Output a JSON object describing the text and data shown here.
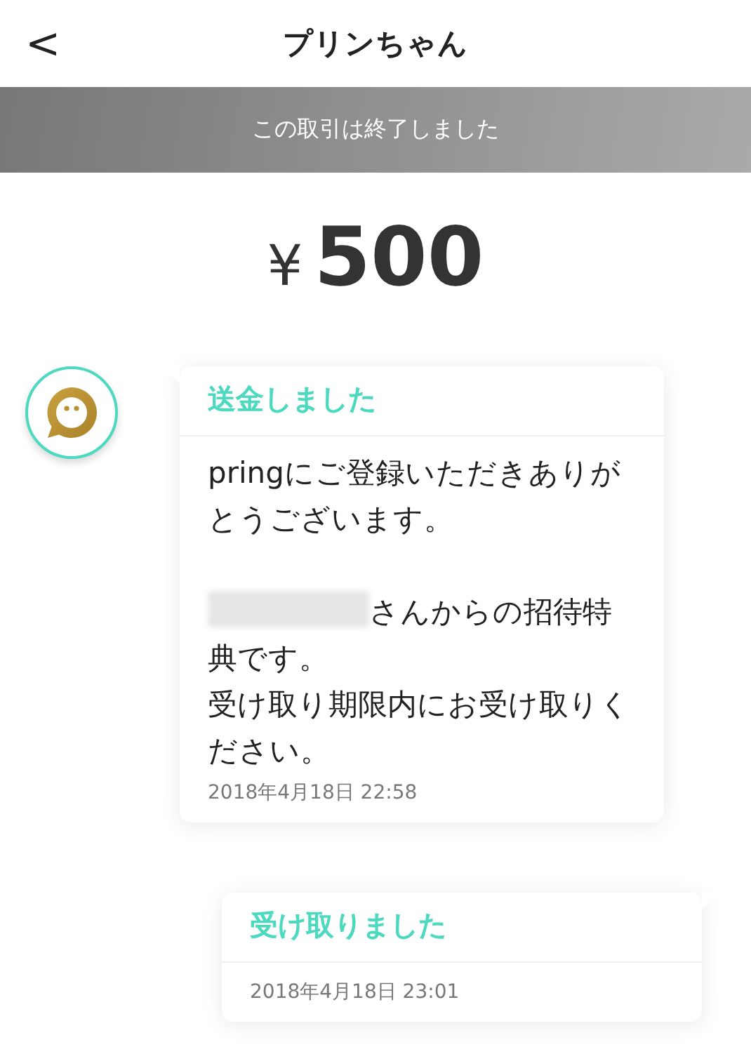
{
  "header": {
    "back": "<",
    "title": "プリンちゃん"
  },
  "status_banner": "この取引は終了しました",
  "amount": {
    "currency": "¥",
    "value": "500"
  },
  "messages": [
    {
      "kind": "received",
      "title": "送金しました",
      "blocks": [
        {
          "lines": [
            {
              "redacted_prefix": false,
              "text": "pringにご登録いただきありがとうございます。"
            }
          ]
        },
        {
          "lines": [
            {
              "redacted_prefix": true,
              "text": "さんからの招待特典です。"
            },
            {
              "redacted_prefix": false,
              "text": "受け取り期限内にお受け取りください。"
            }
          ]
        }
      ],
      "time": "2018年4月18日 22:58"
    },
    {
      "kind": "sent",
      "title": "受け取りました",
      "time": "2018年4月18日 23:01"
    }
  ]
}
